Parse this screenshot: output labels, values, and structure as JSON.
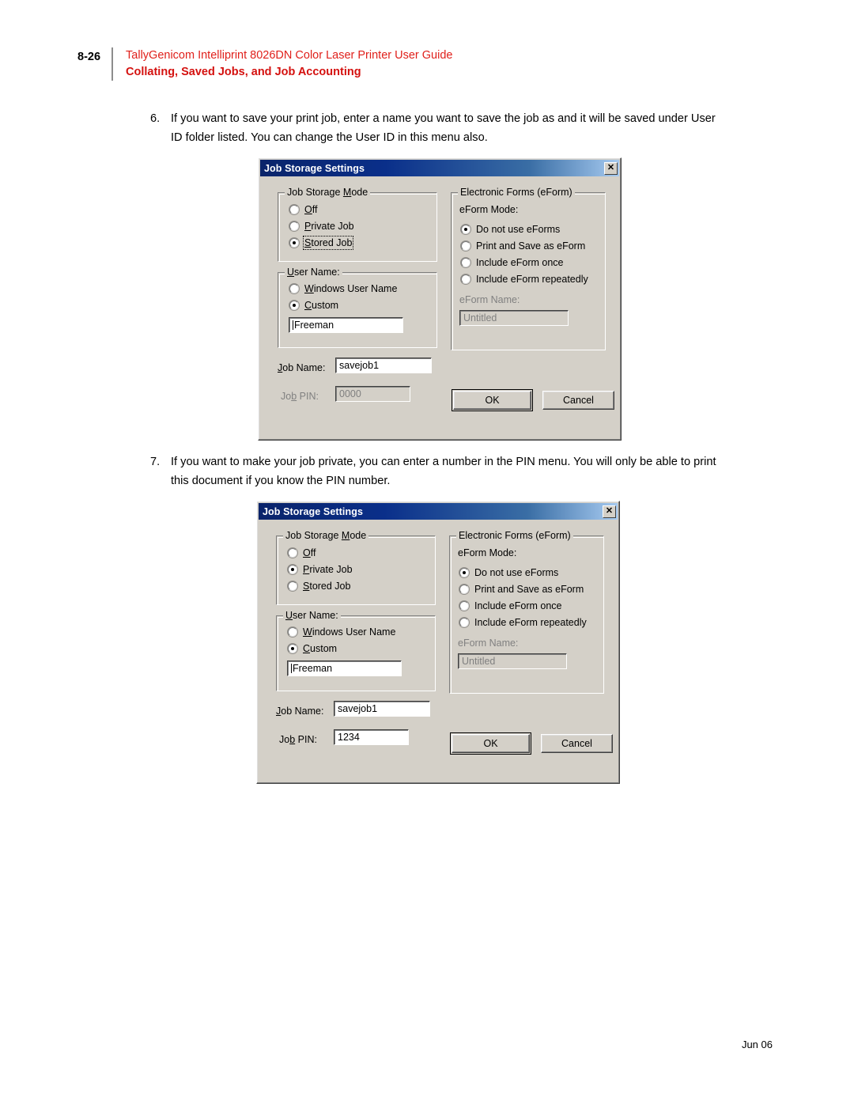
{
  "header": {
    "page_number": "8-26",
    "guide_title": "TallyGenicom Intelliprint 8026DN Color Laser Printer User Guide",
    "section_title": "Collating, Saved Jobs, and Job Accounting",
    "accent_color": "#d4110f"
  },
  "steps": [
    {
      "number": "6.",
      "text": "If you want to save your print job, enter a name you want to save the job as and it will be saved under User ID folder listed.  You can change the User ID in this menu also."
    },
    {
      "number": "7.",
      "text": "If you want to make your job private, you can enter a number in the PIN menu.  You will only be able to print this document if you know the PIN number."
    }
  ],
  "dialog1": {
    "title": "Job Storage Settings",
    "close_label": "✕",
    "job_storage_mode": {
      "legend": "Job Storage Mode",
      "options": [
        {
          "label": "Off",
          "accel": "O",
          "checked": false,
          "focused": false
        },
        {
          "label": "Private Job",
          "accel": "P",
          "checked": false,
          "focused": false
        },
        {
          "label": "Stored Job",
          "accel": "S",
          "checked": true,
          "focused": true
        }
      ]
    },
    "user_name": {
      "legend": "User Name:",
      "options": [
        {
          "label": "Windows User Name",
          "accel": "W",
          "checked": false
        },
        {
          "label": "Custom",
          "accel": "C",
          "checked": true
        }
      ],
      "custom_value": "Freeman",
      "custom_caret": true
    },
    "job_name": {
      "label": "Job Name:",
      "value": "savejob1",
      "disabled": false
    },
    "job_pin": {
      "label": "Job PIN:",
      "value": "0000",
      "disabled": true
    },
    "eform": {
      "legend": "Electronic Forms (eForm)",
      "mode_label": "eForm Mode:",
      "options": [
        {
          "label": "Do not use eForms",
          "checked": true
        },
        {
          "label": "Print and Save as eForm",
          "checked": false
        },
        {
          "label": "Include eForm once",
          "checked": false
        },
        {
          "label": "Include eForm repeatedly",
          "checked": false
        }
      ],
      "name_label": "eForm Name:",
      "name_value": "Untitled",
      "name_disabled": true
    },
    "buttons": {
      "ok": "OK",
      "cancel": "Cancel"
    }
  },
  "dialog2": {
    "title": "Job Storage Settings",
    "close_label": "✕",
    "job_storage_mode": {
      "legend": "Job Storage Mode",
      "options": [
        {
          "label": "Off",
          "accel": "O",
          "checked": false,
          "focused": false
        },
        {
          "label": "Private Job",
          "accel": "P",
          "checked": true,
          "focused": false
        },
        {
          "label": "Stored Job",
          "accel": "S",
          "checked": false,
          "focused": false
        }
      ]
    },
    "user_name": {
      "legend": "User Name:",
      "options": [
        {
          "label": "Windows User Name",
          "accel": "W",
          "checked": false
        },
        {
          "label": "Custom",
          "accel": "C",
          "checked": true
        }
      ],
      "custom_value": "Freeman",
      "custom_caret": true
    },
    "job_name": {
      "label": "Job Name:",
      "value": "savejob1",
      "disabled": false
    },
    "job_pin": {
      "label": "Job PIN:",
      "value": "1234",
      "disabled": false
    },
    "eform": {
      "legend": "Electronic Forms (eForm)",
      "mode_label": "eForm Mode:",
      "options": [
        {
          "label": "Do not use eForms",
          "checked": true
        },
        {
          "label": "Print and Save as eForm",
          "checked": false
        },
        {
          "label": "Include eForm once",
          "checked": false
        },
        {
          "label": "Include eForm repeatedly",
          "checked": false
        }
      ],
      "name_label": "eForm Name:",
      "name_value": "Untitled",
      "name_disabled": true
    },
    "buttons": {
      "ok": "OK",
      "cancel": "Cancel"
    }
  },
  "footer": {
    "date": "Jun 06"
  }
}
